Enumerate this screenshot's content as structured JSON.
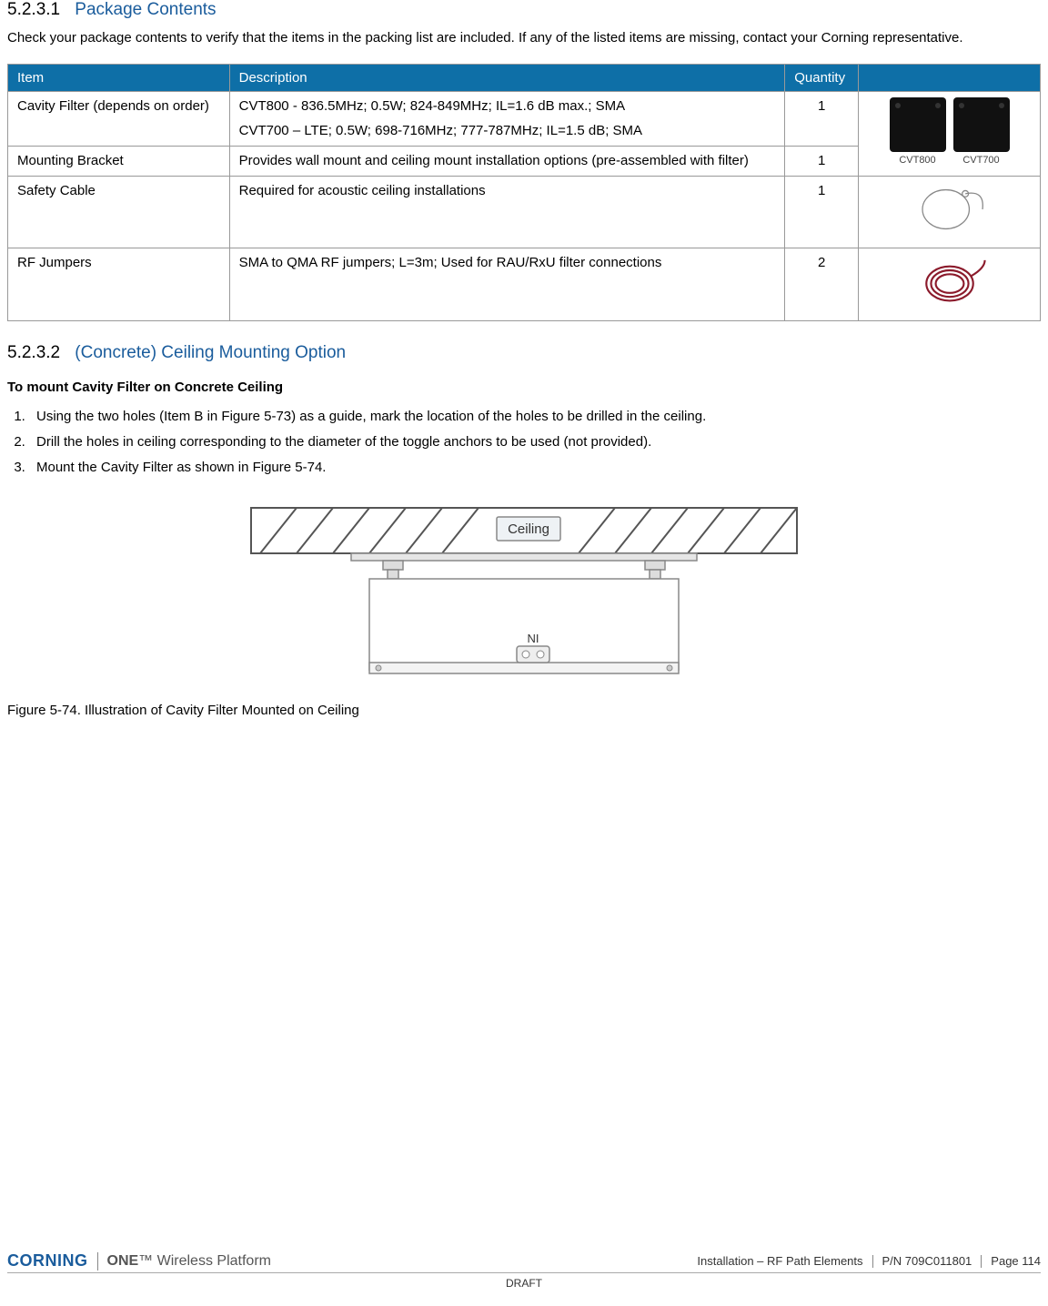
{
  "sections": {
    "s1": {
      "num": "5.2.3.1",
      "title": "Package Contents"
    },
    "s2": {
      "num": "5.2.3.2",
      "title": "(Concrete) Ceiling Mounting Option"
    }
  },
  "intro": "Check your package contents to verify that the items in the packing list are included. If any of the listed items are missing, contact your Corning representative.",
  "table": {
    "headers": {
      "item": "Item",
      "desc": "Description",
      "qty": "Quantity",
      "img": ""
    },
    "rows": [
      {
        "item": "Cavity Filter (depends on order)",
        "desc1": "CVT800 - 836.5MHz; 0.5W; 824-849MHz; IL=1.6 dB max.; SMA",
        "desc2": "CVT700 – LTE; 0.5W; 698-716MHz; 777-787MHz; IL=1.5 dB; SMA",
        "qty": "1",
        "img_labels": {
          "a": "CVT800",
          "b": "CVT700"
        }
      },
      {
        "item": "Mounting Bracket",
        "desc": "Provides wall mount and ceiling mount installation options (pre-assembled with filter)",
        "qty": "1"
      },
      {
        "item": "Safety Cable",
        "desc": "Required for acoustic ceiling installations",
        "qty": "1"
      },
      {
        "item": "RF Jumpers",
        "desc": "SMA to QMA   RF jumpers; L=3m; Used for RAU/RxU filter connections",
        "qty": "2"
      }
    ]
  },
  "mount": {
    "heading": "To mount Cavity Filter on Concrete Ceiling",
    "steps": [
      "Using the two holes (Item B in Figure  5-73) as a guide, mark the location of the holes to be drilled in the ceiling.",
      "Drill the holes in ceiling corresponding to the diameter of the toggle anchors to be used (not provided).",
      "Mount the Cavity Filter as shown in Figure  5-74."
    ]
  },
  "figure": {
    "ceiling_label": "Ceiling",
    "ni_label": "NI",
    "caption": "Figure  5-74. Illustration of Cavity Filter Mounted on Ceiling"
  },
  "footer": {
    "brand": "CORNING",
    "one": "ONE",
    "one_suffix": "™ Wireless Platform",
    "section": "Installation – RF Path Elements",
    "pn": "P/N 709C011801",
    "page": "Page 114",
    "draft": "DRAFT"
  }
}
